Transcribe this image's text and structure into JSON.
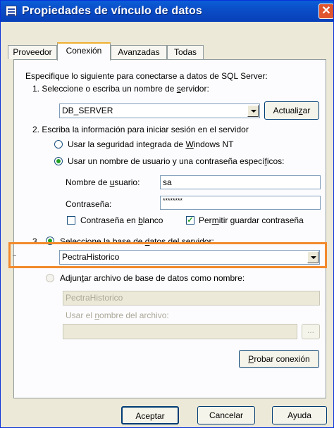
{
  "window": {
    "title": "Propiedades de vínculo de datos",
    "close_glyph": "✕"
  },
  "tabs": [
    {
      "label": "Proveedor",
      "active": false
    },
    {
      "label": "Conexión",
      "active": true
    },
    {
      "label": "Avanzadas",
      "active": false
    },
    {
      "label": "Todas",
      "active": false
    }
  ],
  "intro": "Especifique lo siguiente para conectarse a datos de SQL Server:",
  "step1": {
    "label_pre": "1. Seleccione o escriba un nombre de ",
    "label_ul": "s",
    "label_post": "ervidor:",
    "server_value": "DB_SERVER",
    "refresh_pre": "Actuali",
    "refresh_ul": "z",
    "refresh_post": "ar"
  },
  "step2": {
    "label": "2. Escriba la información para iniciar sesión en el servidor",
    "radio_windows_pre": "Usar la seguridad integrada de ",
    "radio_windows_ul": "W",
    "radio_windows_post": "indows NT",
    "radio_user": "Usar un nombre de usuario y una contraseña especí",
    "radio_user_ul": "f",
    "radio_user_post": "icos:",
    "username_label_pre": "Nombre de ",
    "username_label_ul": "u",
    "username_label_post": "suario:",
    "username_value": "sa",
    "password_label": "Contraseña:",
    "password_value": "********",
    "blank_pw_pre": "Contraseña en ",
    "blank_pw_ul": "b",
    "blank_pw_post": "lanco",
    "blank_pw_checked": false,
    "save_pw_pre": "Per",
    "save_pw_ul": "m",
    "save_pw_post": "itir guardar contraseña",
    "save_pw_checked": true
  },
  "step3": {
    "number": "3.",
    "select_db_pre": "Seleccione la base de ",
    "select_db_ul": "d",
    "select_db_post": "atos del servidor:",
    "database_value": "PectraHistorico",
    "attach_pre": "Adjun",
    "attach_ul": "t",
    "attach_post": "ar archivo de base de datos como nombre:",
    "attach_name_value": "PectraHistorico",
    "filename_label_pre": "Usar el ",
    "filename_label_ul": "n",
    "filename_label_post": "ombre del archivo:",
    "filename_value": "",
    "browse_label": "..."
  },
  "test_button": {
    "pre": "",
    "ul": "P",
    "post": "robar conexión"
  },
  "footer": {
    "ok": "Aceptar",
    "cancel": "Cancelar",
    "help": "Ayuda"
  },
  "colors": {
    "titlebar": "#0a4ec8",
    "highlight": "#f28a2c",
    "tab_active_accent": "#f0b033",
    "check_green": "#21a121"
  }
}
